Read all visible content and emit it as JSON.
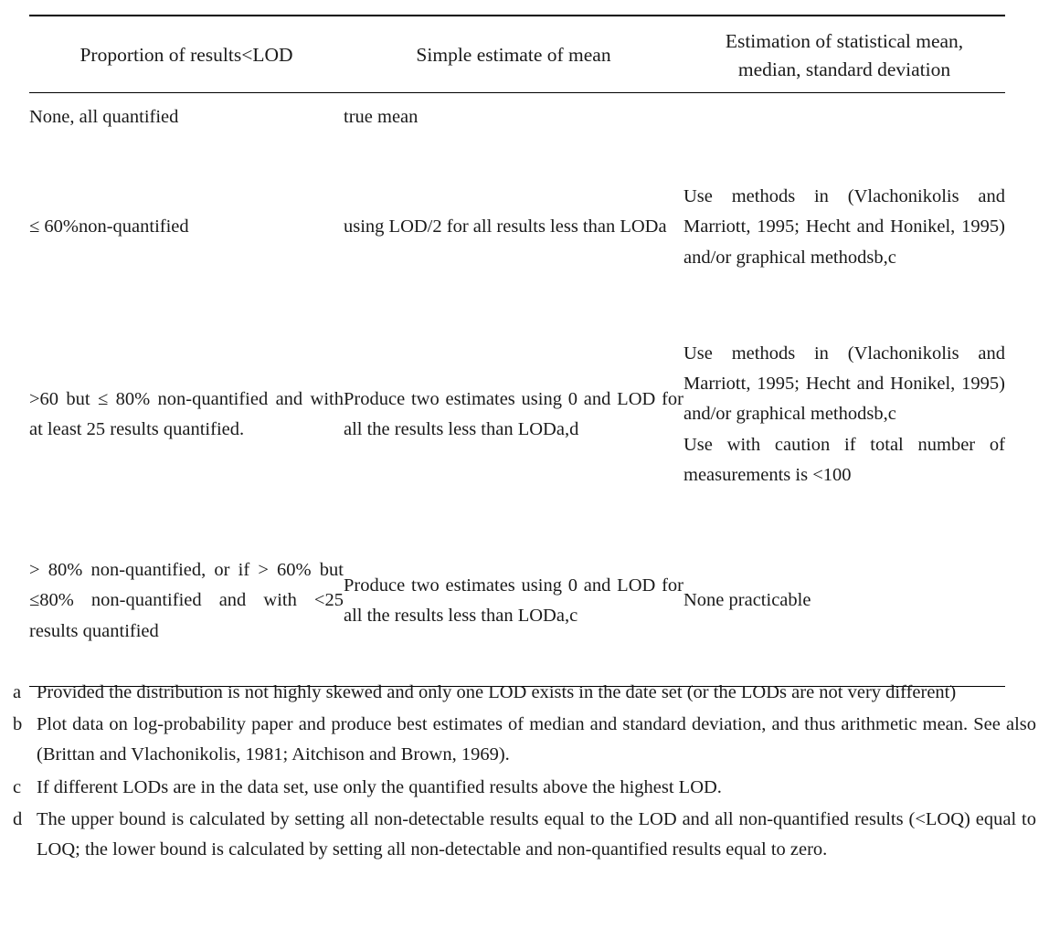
{
  "document": {
    "type": "table-with-footnotes",
    "background_color": "#ffffff",
    "text_color": "#1a1a1a",
    "rule_color": "#000000"
  },
  "table": {
    "headers": {
      "col1": "Proportion of results<LOD",
      "col2": "Simple estimate of mean",
      "col3_line1": "Estimation of statistical mean,",
      "col3_line2": "median, standard deviation"
    },
    "rows": [
      {
        "proportion": "None, all quantified",
        "simple_estimate": "true mean",
        "statistical_estimation": "",
        "statistical_estimation_2": ""
      },
      {
        "proportion": "≤ 60%non-quantified",
        "simple_estimate": "using LOD/2 for all results less than LODa",
        "statistical_estimation": "Use methods in (Vlachonikolis and Marriott, 1995; Hecht and Honikel, 1995) and/or graphical methodsb,c",
        "statistical_estimation_2": ""
      },
      {
        "proportion": ">60 but ≤ 80% non-quantified and with at least 25 results quantified.",
        "simple_estimate": "Produce two estimates using 0 and LOD for all the results less than LODa,d",
        "statistical_estimation": "Use methods in (Vlachonikolis and Marriott, 1995; Hecht and Honikel, 1995) and/or graphical methodsb,c",
        "statistical_estimation_2": "Use with caution if total number of measurements is <100"
      },
      {
        "proportion": "> 80% non-quantified, or if > 60% but ≤80% non-quantified and with <25 results quantified",
        "simple_estimate": "Produce two estimates using 0 and LOD for all the results less than LODa,c",
        "statistical_estimation": "None practicable",
        "statistical_estimation_2": ""
      }
    ]
  },
  "footnotes": [
    {
      "marker": "a",
      "text": "Provided the distribution is not highly skewed and only one LOD exists in the date set (or the LODs are not very different)"
    },
    {
      "marker": "b",
      "text": "Plot data on log-probability paper and produce best estimates of median and standard deviation, and thus arithmetic mean. See also (Brittan and Vlachonikolis, 1981; Aitchison and Brown, 1969)."
    },
    {
      "marker": "c",
      "text": "If different LODs are in the data set, use only the quantified results above the highest LOD."
    },
    {
      "marker": "d",
      "text": "The upper bound is calculated by setting all non-detectable results equal to the LOD and all non-quantified results (<LOQ) equal to LOQ; the lower bound is calculated by setting all non-detectable and non-quantified results equal to zero."
    }
  ]
}
